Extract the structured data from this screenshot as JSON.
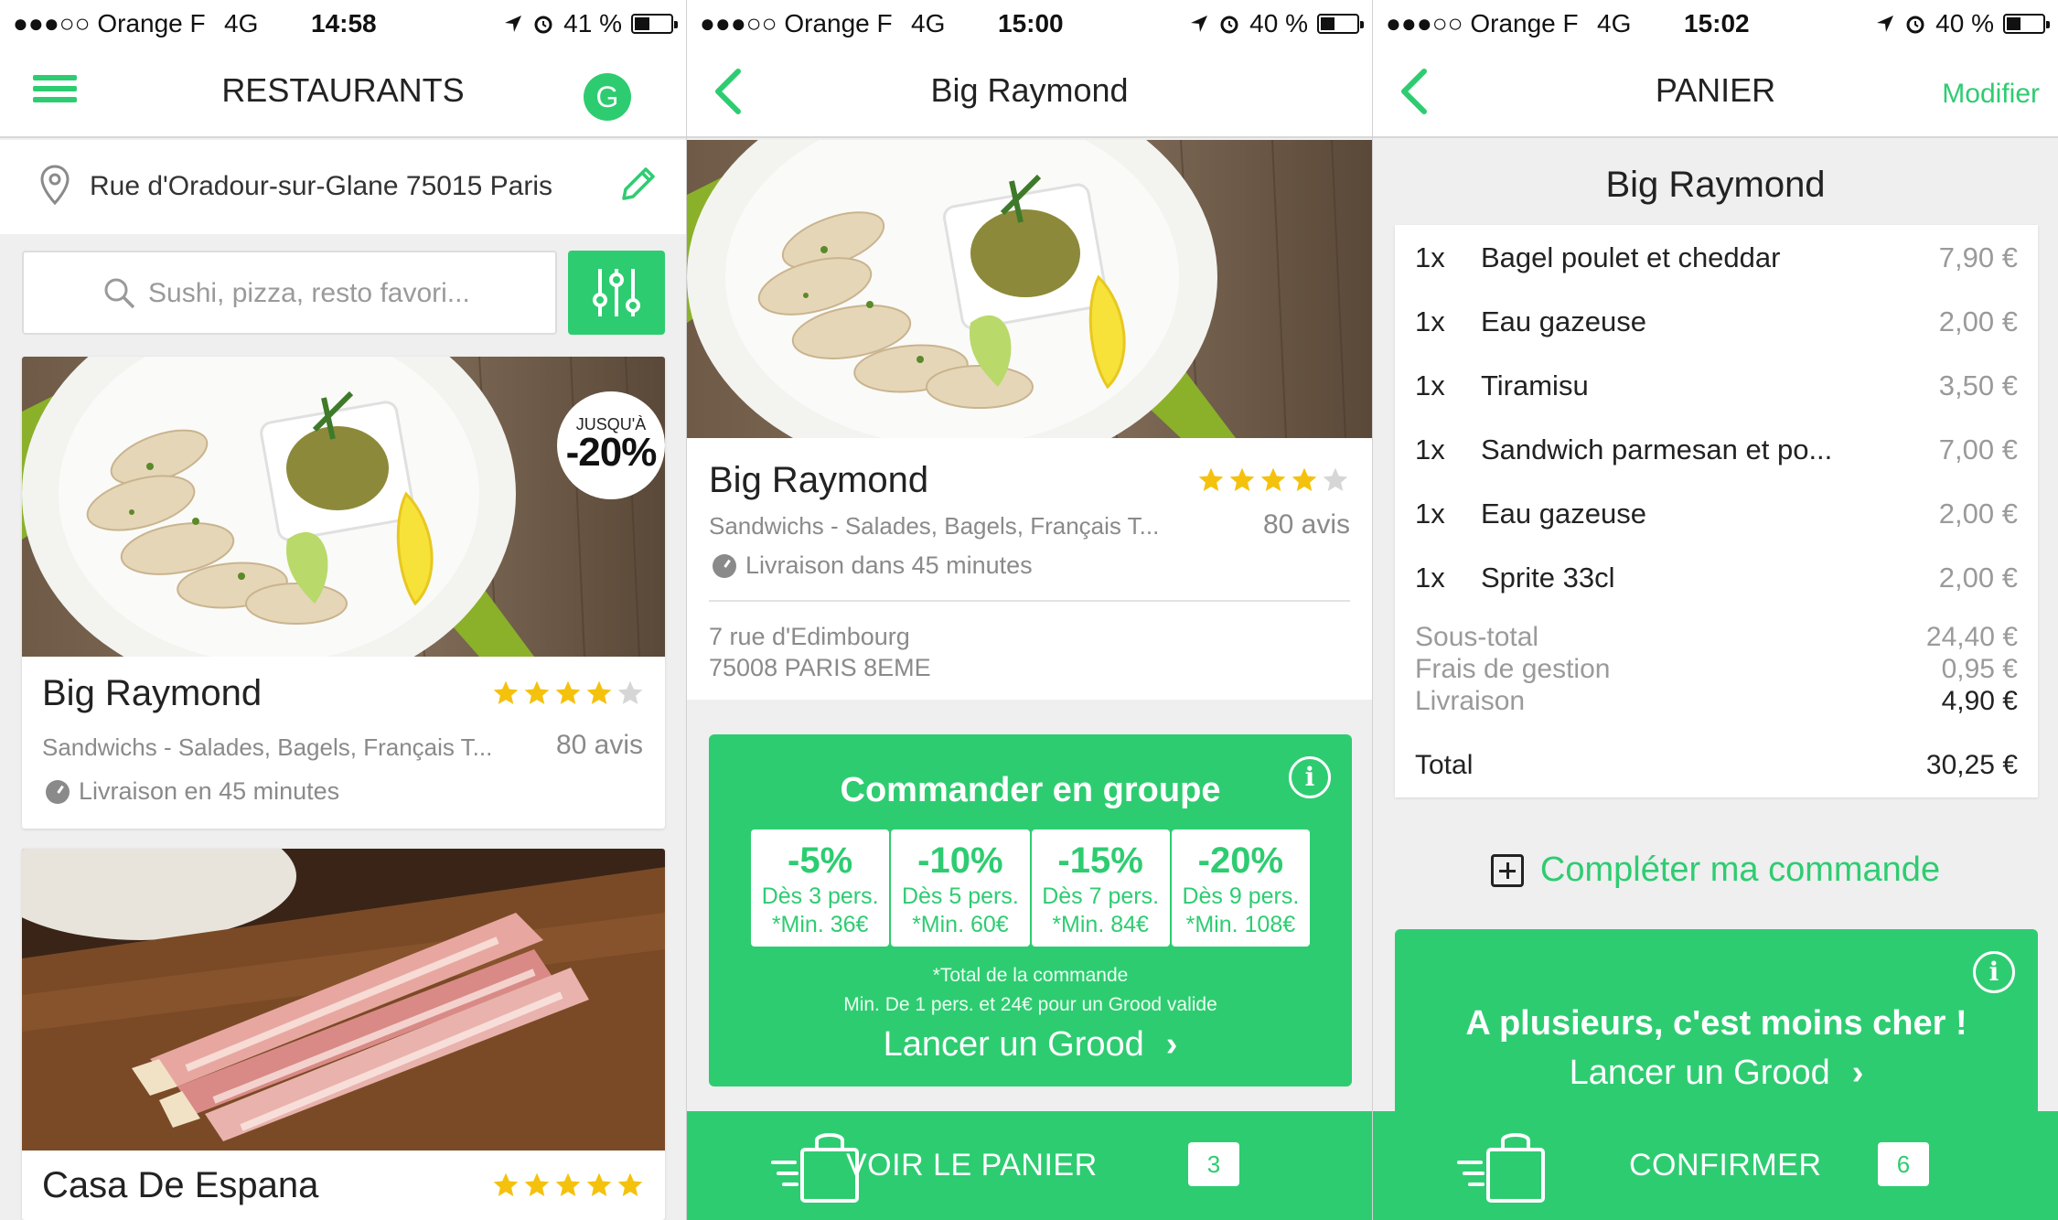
{
  "screens": [
    {
      "status": {
        "carrier": "●●●○○ Orange F",
        "network": "4G",
        "time": "14:58",
        "battery": "41 %",
        "battery_level": 0.41
      },
      "nav": {
        "title": "RESTAURANTS",
        "avatar_initial": "G"
      },
      "address": "Rue d'Oradour-sur-Glane 75015 Paris",
      "search": {
        "placeholder": "Sushi, pizza, resto favori..."
      },
      "restaurants": [
        {
          "discount_top": "JUSQU'À",
          "discount": "-20%",
          "name": "Big Raymond",
          "rating": 4,
          "max_rating": 5,
          "cuisine": "Sandwichs - Salades, Bagels, Français T...",
          "reviews": "80 avis",
          "delivery": "Livraison en 45 minutes"
        },
        {
          "name": "Casa De Espana",
          "rating": 5,
          "max_rating": 5
        }
      ]
    },
    {
      "status": {
        "carrier": "●●●○○ Orange F",
        "network": "4G",
        "time": "15:00",
        "battery": "40 %",
        "battery_level": 0.4
      },
      "nav": {
        "title": "Big Raymond"
      },
      "restaurant": {
        "name": "Big Raymond",
        "rating": 4,
        "max_rating": 5,
        "cuisine": "Sandwichs - Salades, Bagels, Français T...",
        "reviews": "80 avis",
        "delivery": "Livraison dans 45 minutes",
        "address_line1": "7 rue d'Edimbourg",
        "address_line2": "75008 PARIS  8EME"
      },
      "group": {
        "title": "Commander en groupe",
        "tiers": [
          {
            "pct": "-5%",
            "who": "Dès 3 pers.",
            "min": "*Min. 36€"
          },
          {
            "pct": "-10%",
            "who": "Dès 5 pers.",
            "min": "*Min. 60€"
          },
          {
            "pct": "-15%",
            "who": "Dès 7 pers.",
            "min": "*Min. 84€"
          },
          {
            "pct": "-20%",
            "who": "Dès 9 pers.",
            "min": "*Min. 108€"
          }
        ],
        "footnote1": "*Total de la commande",
        "footnote2": "Min. De 1 pers. et 24€ pour un Grood valide",
        "launch": "Lancer un Grood"
      },
      "bottom": {
        "label": "VOIR LE PANIER",
        "count": "3"
      }
    },
    {
      "status": {
        "carrier": "●●●○○ Orange F",
        "network": "4G",
        "time": "15:02",
        "battery": "40 %",
        "battery_level": 0.4
      },
      "nav": {
        "title": "PANIER",
        "action": "Modifier"
      },
      "restaurant_name": "Big Raymond",
      "items": [
        {
          "qty": "1x",
          "name": "Bagel poulet et cheddar",
          "price": "7,90 €"
        },
        {
          "qty": "1x",
          "name": "Eau gazeuse",
          "price": "2,00 €"
        },
        {
          "qty": "1x",
          "name": "Tiramisu",
          "price": "3,50 €"
        },
        {
          "qty": "1x",
          "name": "Sandwich parmesan et po...",
          "price": "7,00 €"
        },
        {
          "qty": "1x",
          "name": "Eau gazeuse",
          "price": "2,00 €"
        },
        {
          "qty": "1x",
          "name": "Sprite 33cl",
          "price": "2,00 €"
        }
      ],
      "summary": {
        "subtotal_label": "Sous-total",
        "subtotal": "24,40 €",
        "fees_label": "Frais de gestion",
        "fees": "0,95 €",
        "delivery_label": "Livraison",
        "delivery": "4,90 €",
        "total_label": "Total",
        "total": "30,25 €"
      },
      "complete": "Compléter ma commande",
      "promo": {
        "title": "A plusieurs, c'est moins cher !",
        "launch": "Lancer un Grood"
      },
      "bottom": {
        "label": "CONFIRMER",
        "count": "6"
      }
    }
  ],
  "colors": {
    "accent": "#2ecc71",
    "star": "#f4c20d"
  }
}
